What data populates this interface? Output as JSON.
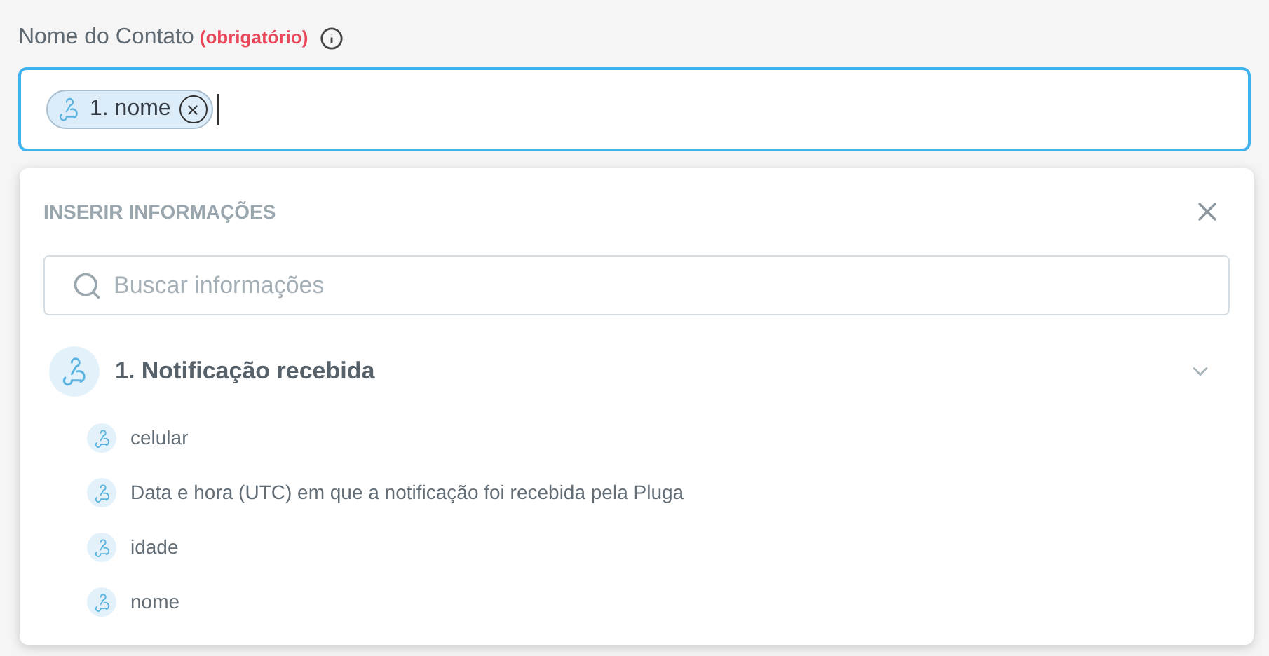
{
  "field": {
    "label": "Nome do Contato",
    "required_note": "(obrigatório)",
    "tokens": [
      {
        "label": "1. nome"
      }
    ]
  },
  "picker": {
    "title": "INSERIR INFORMAÇÕES",
    "search": {
      "placeholder": "Buscar informações"
    },
    "groups": [
      {
        "label": "1. Notificação recebida",
        "expanded": true,
        "items": [
          {
            "label": "celular"
          },
          {
            "label": "Data e hora (UTC) em que a notificação foi recebida pela Pluga"
          },
          {
            "label": "idade"
          },
          {
            "label": "nome"
          }
        ]
      }
    ]
  }
}
